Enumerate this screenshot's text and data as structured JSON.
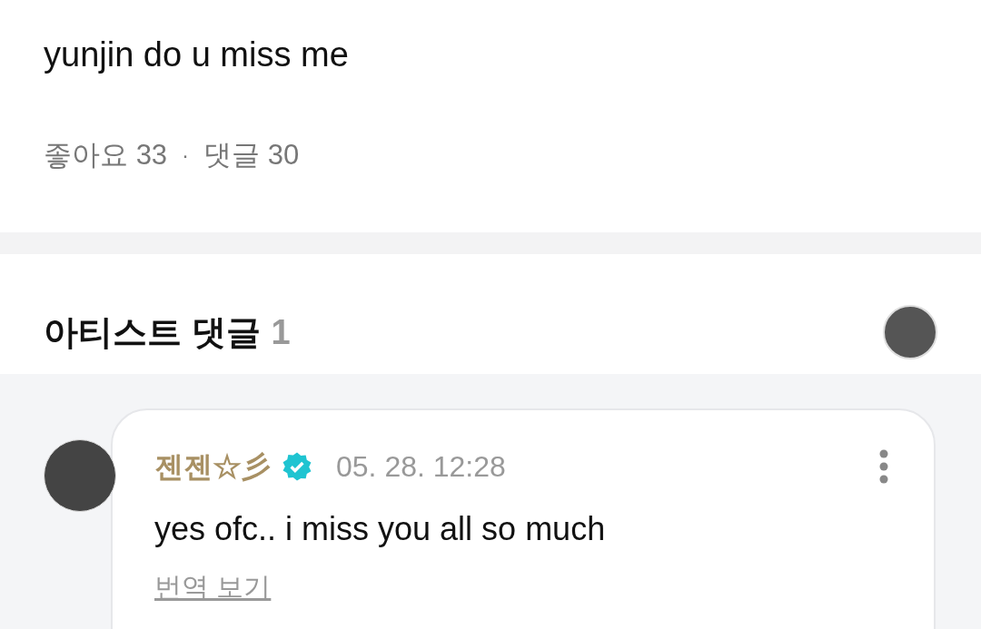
{
  "post": {
    "text": "yunjin do u miss me",
    "likes_label": "좋아요",
    "likes": "33",
    "separator": "·",
    "comments_label": "댓글",
    "comments": "30"
  },
  "artist_comments": {
    "title": "아티스트 댓글",
    "count": "1",
    "items": [
      {
        "author": "젠젠☆彡",
        "verified": true,
        "time": "05. 28. 12:28",
        "text": "yes ofc.. i miss you all so much",
        "translate": "번역 보기"
      }
    ]
  }
}
